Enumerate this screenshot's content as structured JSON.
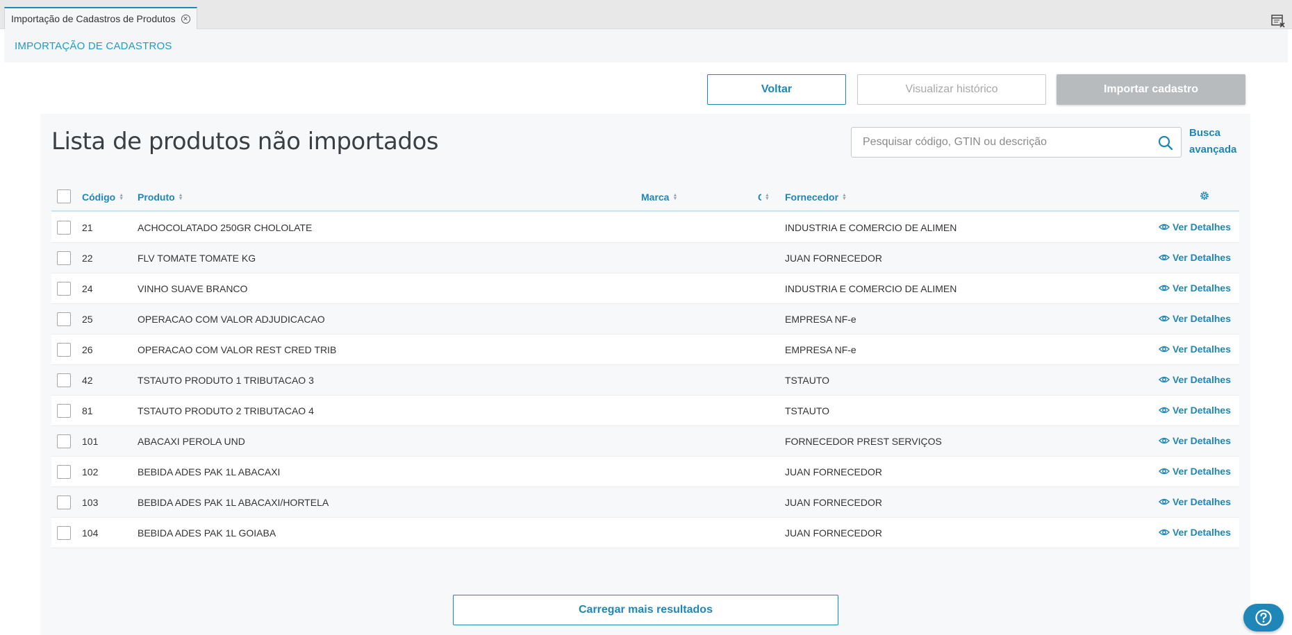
{
  "tab": {
    "title": "Importação de Cadastros de Produtos",
    "close_icon": "close-circle-icon"
  },
  "breadcrumb": "IMPORTAÇÃO DE CADASTROS",
  "actions": {
    "voltar": "Voltar",
    "historico": "Visualizar histórico",
    "importar": "Importar cadastro"
  },
  "list": {
    "title": "Lista de produtos não importados",
    "search_placeholder": "Pesquisar código, GTIN ou descrição",
    "advanced_search": "Busca avançada",
    "columns": {
      "codigo": "Código",
      "produto": "Produto",
      "marca": "Marca",
      "fornecedor": "Fornecedor",
      "truncated_col": "C"
    },
    "row_action": "Ver Detalhes",
    "rows": [
      {
        "codigo": "21",
        "produto": "ACHOCOLATADO 250GR CHOLOLATE",
        "fornecedor": "INDUSTRIA E COMERCIO DE ALIMEN"
      },
      {
        "codigo": "22",
        "produto": "FLV TOMATE TOMATE KG",
        "fornecedor": "JUAN FORNECEDOR"
      },
      {
        "codigo": "24",
        "produto": "VINHO SUAVE BRANCO",
        "fornecedor": "INDUSTRIA E COMERCIO DE ALIMEN"
      },
      {
        "codigo": "25",
        "produto": "OPERACAO COM VALOR ADJUDICACAO",
        "fornecedor": "EMPRESA NF-e"
      },
      {
        "codigo": "26",
        "produto": "OPERACAO COM VALOR REST CRED TRIB",
        "fornecedor": "EMPRESA NF-e"
      },
      {
        "codigo": "42",
        "produto": "TSTAUTO PRODUTO 1 TRIBUTACAO 3",
        "fornecedor": "TSTAUTO"
      },
      {
        "codigo": "81",
        "produto": "TSTAUTO PRODUTO 2 TRIBUTACAO 4",
        "fornecedor": "TSTAUTO"
      },
      {
        "codigo": "101",
        "produto": "ABACAXI PEROLA UND",
        "fornecedor": "FORNECEDOR PREST SERVIÇOS"
      },
      {
        "codigo": "102",
        "produto": "BEBIDA ADES PAK 1L ABACAXI",
        "fornecedor": "JUAN FORNECEDOR"
      },
      {
        "codigo": "103",
        "produto": "BEBIDA ADES PAK 1L ABACAXI/HORTELA",
        "fornecedor": "JUAN FORNECEDOR"
      },
      {
        "codigo": "104",
        "produto": "BEBIDA ADES PAK 1L GOIABA",
        "fornecedor": "JUAN FORNECEDOR"
      }
    ],
    "load_more": "Carregar mais resultados"
  },
  "colors": {
    "accent": "#1f86b8",
    "disabled": "#b8bbbd"
  }
}
